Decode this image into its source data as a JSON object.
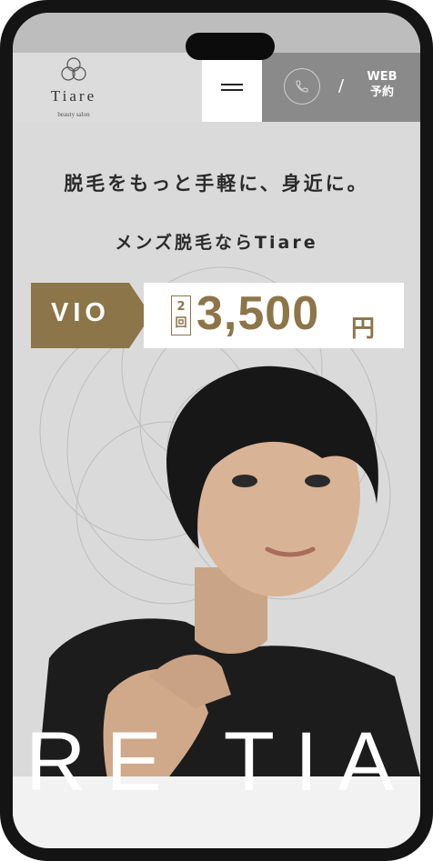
{
  "header": {
    "logo_text": "Tiare",
    "logo_sub": "beauty salon",
    "slash": "/",
    "web_line1": "WEB",
    "web_line2": "予約"
  },
  "hero": {
    "headline": "脱毛をもっと手軽に、身近に。",
    "subline": "メンズ脱毛ならTiare",
    "badge": "VIO",
    "times_top": "2",
    "times_bottom": "回",
    "price": "3,500",
    "currency": "円",
    "big_word": "RE TIA"
  },
  "colors": {
    "accent_gold": "#8c7549",
    "header_gray": "#8a8a8a",
    "background": "#dadada"
  },
  "icons": {
    "menu": "hamburger-menu-icon",
    "phone": "phone-icon",
    "logo_mark": "interlocking-circles-logo"
  }
}
